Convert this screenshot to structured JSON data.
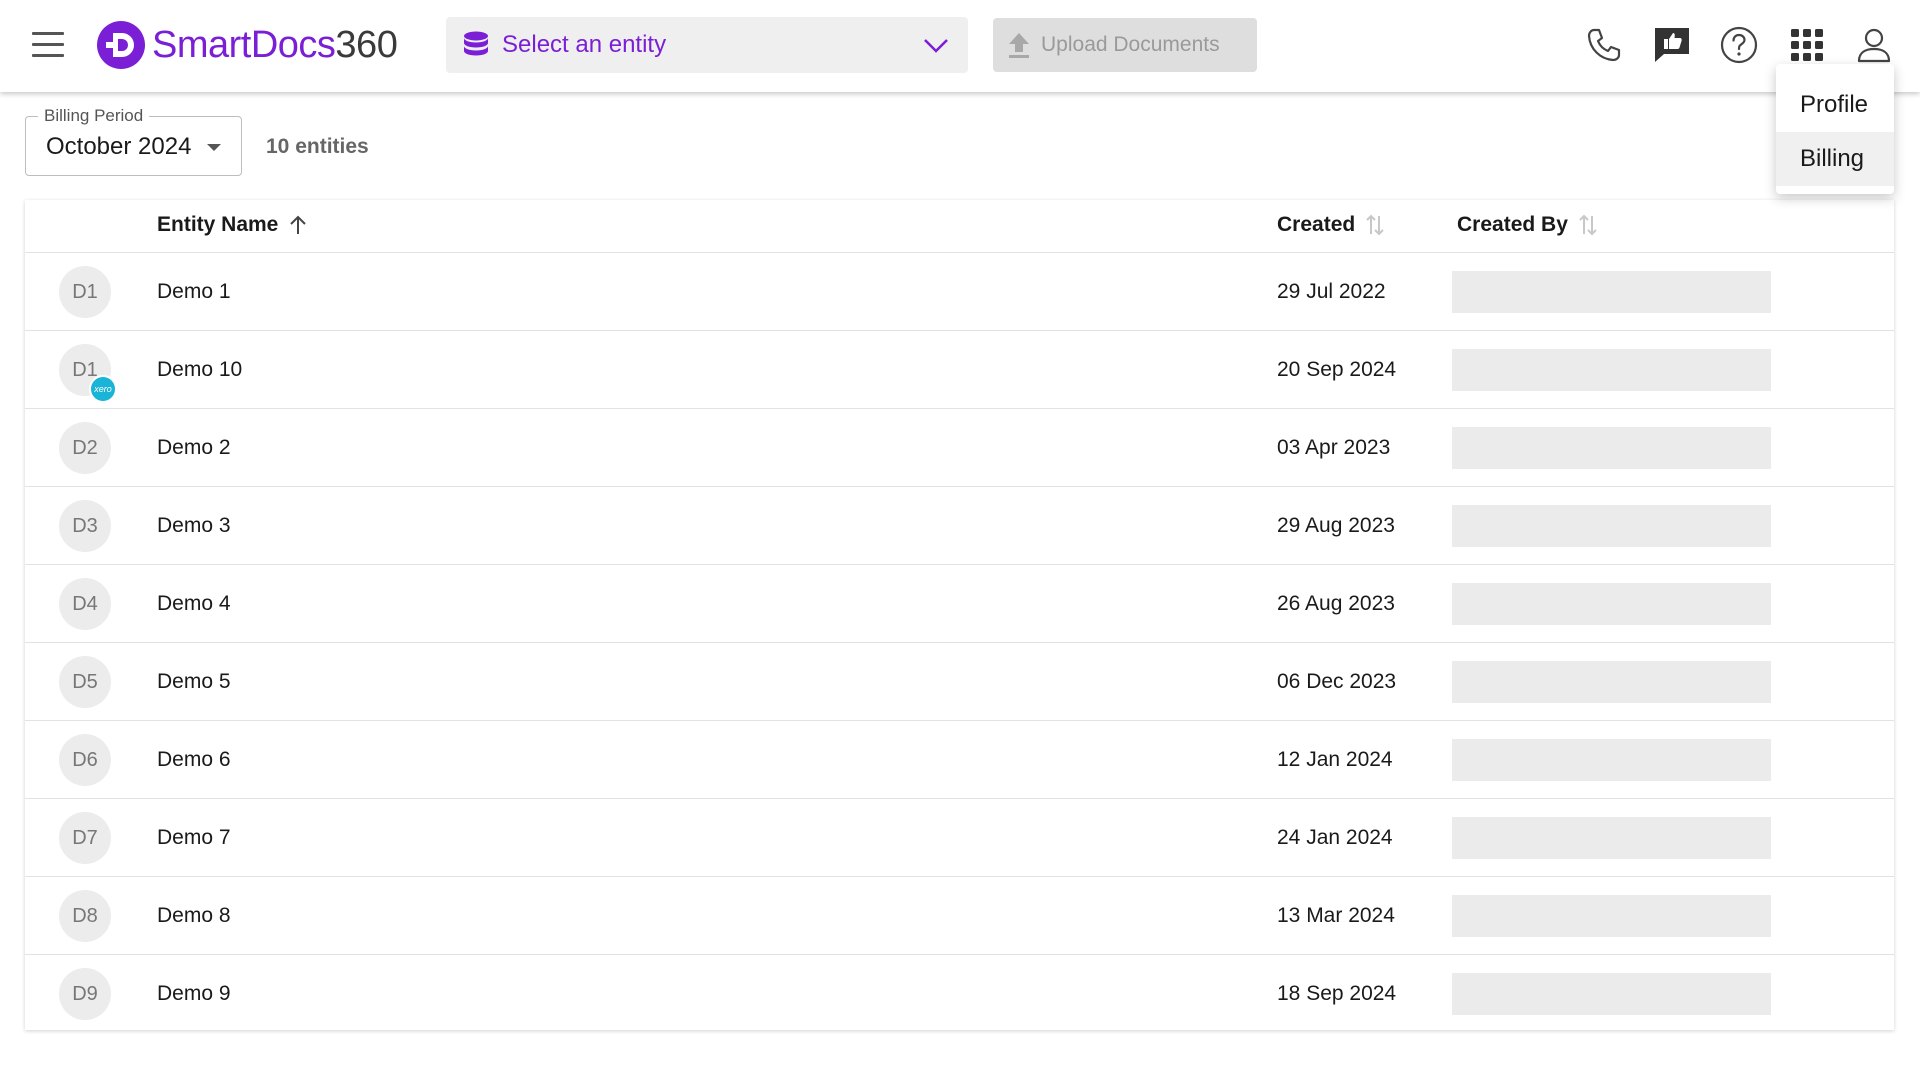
{
  "header": {
    "logo_smart": "SmartDocs",
    "logo_360": "360",
    "entity_select_label": "Select an entity",
    "upload_label": "Upload Documents"
  },
  "user_menu": {
    "items": [
      {
        "label": "Profile"
      },
      {
        "label": "Billing"
      }
    ]
  },
  "billing_period": {
    "legend": "Billing Period",
    "value": "October 2024"
  },
  "entity_count": "10 entities",
  "table": {
    "columns": {
      "name": "Entity Name",
      "created": "Created",
      "created_by": "Created By"
    },
    "rows": [
      {
        "initials": "D1",
        "name": "Demo 1",
        "created": "29 Jul 2022",
        "xero": false
      },
      {
        "initials": "D1",
        "name": "Demo 10",
        "created": "20 Sep 2024",
        "xero": true,
        "xero_label": "xero"
      },
      {
        "initials": "D2",
        "name": "Demo 2",
        "created": "03 Apr 2023",
        "xero": false
      },
      {
        "initials": "D3",
        "name": "Demo 3",
        "created": "29 Aug 2023",
        "xero": false
      },
      {
        "initials": "D4",
        "name": "Demo 4",
        "created": "26 Aug 2023",
        "xero": false
      },
      {
        "initials": "D5",
        "name": "Demo 5",
        "created": "06 Dec 2023",
        "xero": false
      },
      {
        "initials": "D6",
        "name": "Demo 6",
        "created": "12 Jan 2024",
        "xero": false
      },
      {
        "initials": "D7",
        "name": "Demo 7",
        "created": "24 Jan 2024",
        "xero": false
      },
      {
        "initials": "D8",
        "name": "Demo 8",
        "created": "13 Mar 2024",
        "xero": false
      },
      {
        "initials": "D9",
        "name": "Demo 9",
        "created": "18 Sep 2024",
        "xero": false
      }
    ]
  },
  "colors": {
    "brand_purple": "#7a1fd6",
    "xero_blue": "#1ab4d7"
  },
  "icons": [
    "menu-icon",
    "logo-icon",
    "database-icon",
    "chevron-down-icon",
    "upload-icon",
    "phone-icon",
    "feedback-icon",
    "help-icon",
    "apps-grid-icon",
    "user-icon",
    "sort-asc-icon",
    "sort-icon"
  ]
}
